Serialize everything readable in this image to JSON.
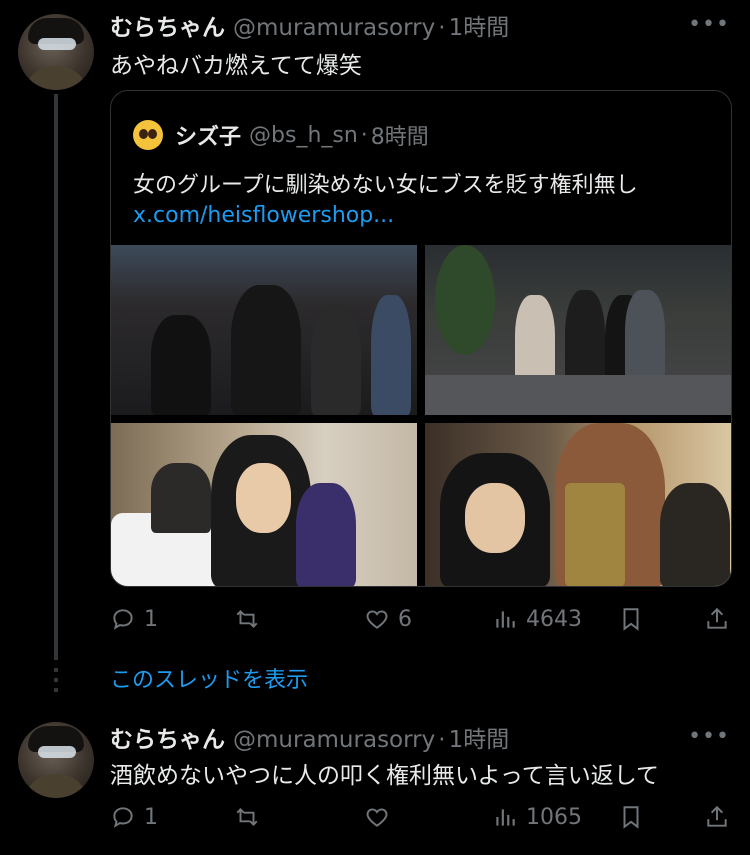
{
  "tweets": [
    {
      "name": "むらちゃん",
      "handle": "@muramurasorry",
      "separator": "·",
      "time": "1時間",
      "text": "あやねバカ燃えてて爆笑",
      "more": "•••",
      "actions": {
        "reply_count": "1",
        "retweet_count": "",
        "like_count": "6",
        "views": "4643"
      }
    },
    {
      "name": "むらちゃん",
      "handle": "@muramurasorry",
      "separator": "·",
      "time": "1時間",
      "text": "酒飲めないやつに人の叩く権利無いよって言い返して",
      "more": "•••",
      "actions": {
        "reply_count": "1",
        "retweet_count": "",
        "like_count": "",
        "views": "1065"
      }
    }
  ],
  "quote": {
    "name": "シズ子",
    "handle": "@bs_h_sn",
    "separator": "·",
    "time": "8時間",
    "text": "女のグループに馴染めない女にブスを貶す権利無し",
    "link": "x.com/heisflowershop..."
  },
  "show_thread": "このスレッドを表示",
  "icons": [
    "reply-icon",
    "retweet-icon",
    "like-icon",
    "views-icon",
    "bookmark-icon",
    "share-icon",
    "more-icon"
  ],
  "colors": {
    "background": "#000000",
    "text": "#e7e9ea",
    "muted": "#71767b",
    "link": "#1d9bf0",
    "border": "#2f3336"
  }
}
